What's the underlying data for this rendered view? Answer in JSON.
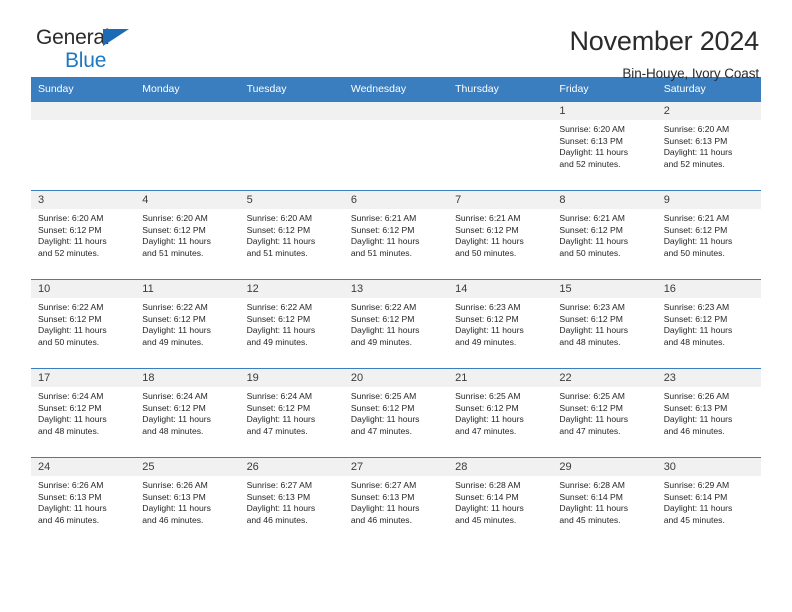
{
  "brand": {
    "name_top": "General",
    "name_bottom": "Blue",
    "accent_color": "#1f78c1",
    "triangle_color": "#1b6cb5"
  },
  "header": {
    "title": "November 2024",
    "subtitle": "Bin-Houye, Ivory Coast"
  },
  "calendar": {
    "header_bg": "#3a7ebf",
    "daynum_bg": "#f1f1f1",
    "weekdays": [
      "Sunday",
      "Monday",
      "Tuesday",
      "Wednesday",
      "Thursday",
      "Friday",
      "Saturday"
    ],
    "weeks": [
      [
        {
          "day": "",
          "blank": true
        },
        {
          "day": "",
          "blank": true
        },
        {
          "day": "",
          "blank": true
        },
        {
          "day": "",
          "blank": true
        },
        {
          "day": "",
          "blank": true
        },
        {
          "day": "1",
          "sunrise": "Sunrise: 6:20 AM",
          "sunset": "Sunset: 6:13 PM",
          "daylight1": "Daylight: 11 hours",
          "daylight2": "and 52 minutes."
        },
        {
          "day": "2",
          "sunrise": "Sunrise: 6:20 AM",
          "sunset": "Sunset: 6:13 PM",
          "daylight1": "Daylight: 11 hours",
          "daylight2": "and 52 minutes."
        }
      ],
      [
        {
          "day": "3",
          "sunrise": "Sunrise: 6:20 AM",
          "sunset": "Sunset: 6:12 PM",
          "daylight1": "Daylight: 11 hours",
          "daylight2": "and 52 minutes."
        },
        {
          "day": "4",
          "sunrise": "Sunrise: 6:20 AM",
          "sunset": "Sunset: 6:12 PM",
          "daylight1": "Daylight: 11 hours",
          "daylight2": "and 51 minutes."
        },
        {
          "day": "5",
          "sunrise": "Sunrise: 6:20 AM",
          "sunset": "Sunset: 6:12 PM",
          "daylight1": "Daylight: 11 hours",
          "daylight2": "and 51 minutes."
        },
        {
          "day": "6",
          "sunrise": "Sunrise: 6:21 AM",
          "sunset": "Sunset: 6:12 PM",
          "daylight1": "Daylight: 11 hours",
          "daylight2": "and 51 minutes."
        },
        {
          "day": "7",
          "sunrise": "Sunrise: 6:21 AM",
          "sunset": "Sunset: 6:12 PM",
          "daylight1": "Daylight: 11 hours",
          "daylight2": "and 50 minutes."
        },
        {
          "day": "8",
          "sunrise": "Sunrise: 6:21 AM",
          "sunset": "Sunset: 6:12 PM",
          "daylight1": "Daylight: 11 hours",
          "daylight2": "and 50 minutes."
        },
        {
          "day": "9",
          "sunrise": "Sunrise: 6:21 AM",
          "sunset": "Sunset: 6:12 PM",
          "daylight1": "Daylight: 11 hours",
          "daylight2": "and 50 minutes."
        }
      ],
      [
        {
          "day": "10",
          "sunrise": "Sunrise: 6:22 AM",
          "sunset": "Sunset: 6:12 PM",
          "daylight1": "Daylight: 11 hours",
          "daylight2": "and 50 minutes."
        },
        {
          "day": "11",
          "sunrise": "Sunrise: 6:22 AM",
          "sunset": "Sunset: 6:12 PM",
          "daylight1": "Daylight: 11 hours",
          "daylight2": "and 49 minutes."
        },
        {
          "day": "12",
          "sunrise": "Sunrise: 6:22 AM",
          "sunset": "Sunset: 6:12 PM",
          "daylight1": "Daylight: 11 hours",
          "daylight2": "and 49 minutes."
        },
        {
          "day": "13",
          "sunrise": "Sunrise: 6:22 AM",
          "sunset": "Sunset: 6:12 PM",
          "daylight1": "Daylight: 11 hours",
          "daylight2": "and 49 minutes."
        },
        {
          "day": "14",
          "sunrise": "Sunrise: 6:23 AM",
          "sunset": "Sunset: 6:12 PM",
          "daylight1": "Daylight: 11 hours",
          "daylight2": "and 49 minutes."
        },
        {
          "day": "15",
          "sunrise": "Sunrise: 6:23 AM",
          "sunset": "Sunset: 6:12 PM",
          "daylight1": "Daylight: 11 hours",
          "daylight2": "and 48 minutes."
        },
        {
          "day": "16",
          "sunrise": "Sunrise: 6:23 AM",
          "sunset": "Sunset: 6:12 PM",
          "daylight1": "Daylight: 11 hours",
          "daylight2": "and 48 minutes."
        }
      ],
      [
        {
          "day": "17",
          "sunrise": "Sunrise: 6:24 AM",
          "sunset": "Sunset: 6:12 PM",
          "daylight1": "Daylight: 11 hours",
          "daylight2": "and 48 minutes."
        },
        {
          "day": "18",
          "sunrise": "Sunrise: 6:24 AM",
          "sunset": "Sunset: 6:12 PM",
          "daylight1": "Daylight: 11 hours",
          "daylight2": "and 48 minutes."
        },
        {
          "day": "19",
          "sunrise": "Sunrise: 6:24 AM",
          "sunset": "Sunset: 6:12 PM",
          "daylight1": "Daylight: 11 hours",
          "daylight2": "and 47 minutes."
        },
        {
          "day": "20",
          "sunrise": "Sunrise: 6:25 AM",
          "sunset": "Sunset: 6:12 PM",
          "daylight1": "Daylight: 11 hours",
          "daylight2": "and 47 minutes."
        },
        {
          "day": "21",
          "sunrise": "Sunrise: 6:25 AM",
          "sunset": "Sunset: 6:12 PM",
          "daylight1": "Daylight: 11 hours",
          "daylight2": "and 47 minutes."
        },
        {
          "day": "22",
          "sunrise": "Sunrise: 6:25 AM",
          "sunset": "Sunset: 6:12 PM",
          "daylight1": "Daylight: 11 hours",
          "daylight2": "and 47 minutes."
        },
        {
          "day": "23",
          "sunrise": "Sunrise: 6:26 AM",
          "sunset": "Sunset: 6:13 PM",
          "daylight1": "Daylight: 11 hours",
          "daylight2": "and 46 minutes."
        }
      ],
      [
        {
          "day": "24",
          "sunrise": "Sunrise: 6:26 AM",
          "sunset": "Sunset: 6:13 PM",
          "daylight1": "Daylight: 11 hours",
          "daylight2": "and 46 minutes."
        },
        {
          "day": "25",
          "sunrise": "Sunrise: 6:26 AM",
          "sunset": "Sunset: 6:13 PM",
          "daylight1": "Daylight: 11 hours",
          "daylight2": "and 46 minutes."
        },
        {
          "day": "26",
          "sunrise": "Sunrise: 6:27 AM",
          "sunset": "Sunset: 6:13 PM",
          "daylight1": "Daylight: 11 hours",
          "daylight2": "and 46 minutes."
        },
        {
          "day": "27",
          "sunrise": "Sunrise: 6:27 AM",
          "sunset": "Sunset: 6:13 PM",
          "daylight1": "Daylight: 11 hours",
          "daylight2": "and 46 minutes."
        },
        {
          "day": "28",
          "sunrise": "Sunrise: 6:28 AM",
          "sunset": "Sunset: 6:14 PM",
          "daylight1": "Daylight: 11 hours",
          "daylight2": "and 45 minutes."
        },
        {
          "day": "29",
          "sunrise": "Sunrise: 6:28 AM",
          "sunset": "Sunset: 6:14 PM",
          "daylight1": "Daylight: 11 hours",
          "daylight2": "and 45 minutes."
        },
        {
          "day": "30",
          "sunrise": "Sunrise: 6:29 AM",
          "sunset": "Sunset: 6:14 PM",
          "daylight1": "Daylight: 11 hours",
          "daylight2": "and 45 minutes."
        }
      ]
    ]
  }
}
